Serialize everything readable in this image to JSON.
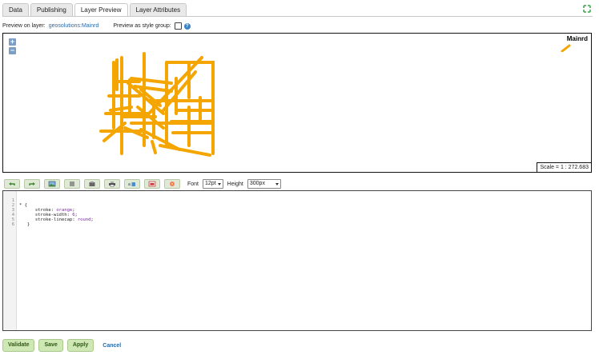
{
  "tabs": [
    {
      "label": "Data"
    },
    {
      "label": "Publishing"
    },
    {
      "label": "Layer Preview"
    },
    {
      "label": "Layer Attributes"
    }
  ],
  "active_tab": "Layer Preview",
  "preview": {
    "label": "Preview on layer:",
    "layer": "geosolutions:Mainrd",
    "style_group_label": "Preview as style group:",
    "style_group_checked": false
  },
  "map": {
    "legend_title": "Mainrd",
    "scale": "Scale = 1 : 272.683",
    "road_color": "#f5a500"
  },
  "toolbar": {
    "icons": [
      "undo-icon",
      "redo-icon",
      "image-icon",
      "list-icon",
      "palette-icon",
      "print-icon",
      "find-replace-icon",
      "chart-icon",
      "color-picker-icon"
    ],
    "font_label": "Font",
    "font_value": "12pt",
    "height_label": "Height",
    "height_value": "300px"
  },
  "editor": {
    "lines": [
      {
        "num": "1",
        "text": "* {"
      },
      {
        "num": "2",
        "text": "      stroke: orange;"
      },
      {
        "num": "3",
        "text": "      stroke-width: 6;"
      },
      {
        "num": "4",
        "text": "      stroke-linecap: round;"
      },
      {
        "num": "5",
        "text": "   }"
      },
      {
        "num": "6",
        "text": ""
      }
    ]
  },
  "actions": {
    "validate": "Validate",
    "save": "Save",
    "apply": "Apply",
    "cancel": "Cancel"
  }
}
